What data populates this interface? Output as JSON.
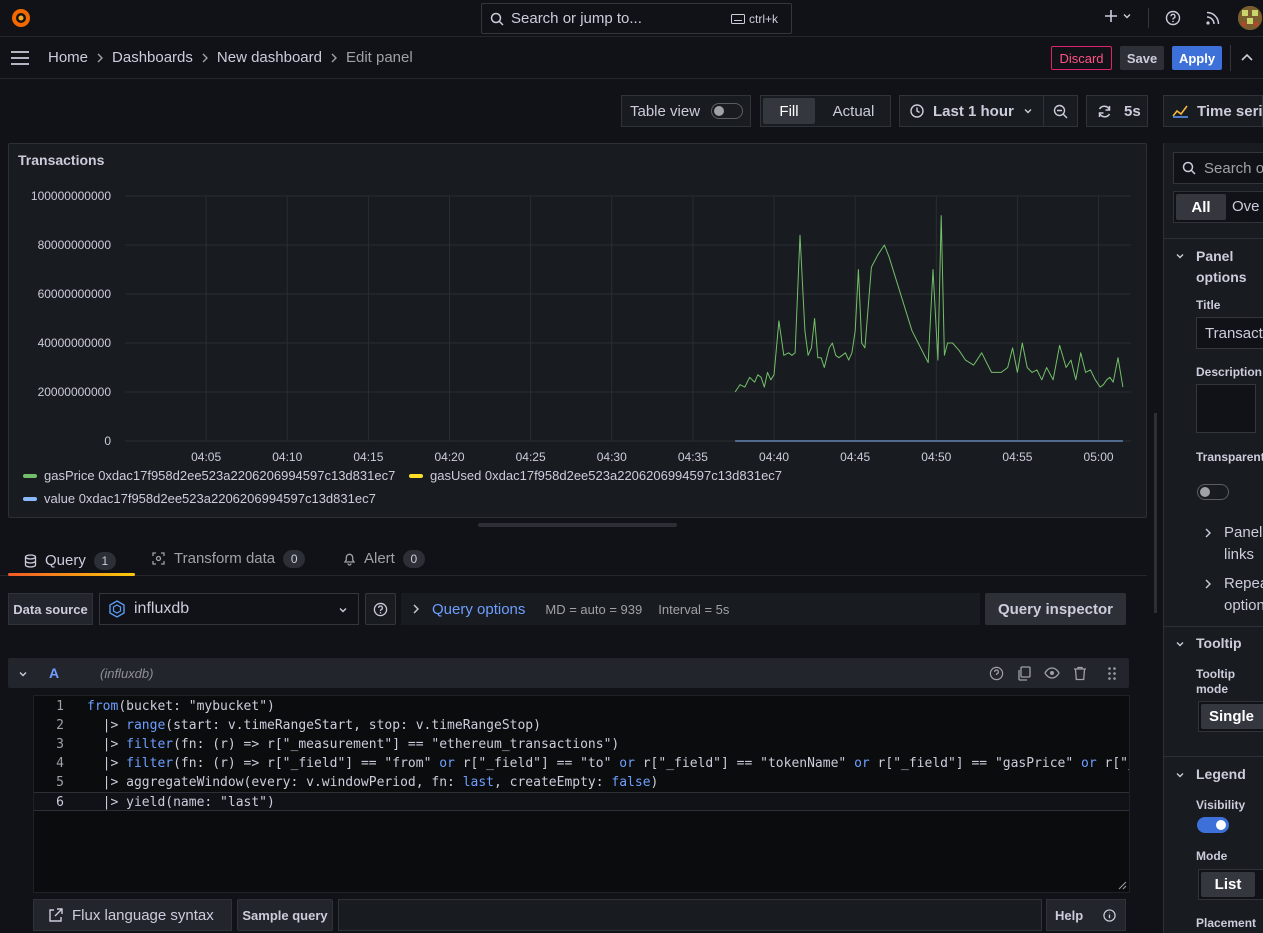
{
  "topbar": {
    "search_placeholder": "Search or jump to...",
    "search_shortcut": "ctrl+k"
  },
  "breadcrumb": {
    "items": [
      "Home",
      "Dashboards",
      "New dashboard",
      "Edit panel"
    ]
  },
  "actions": {
    "discard": "Discard",
    "save": "Save",
    "apply": "Apply"
  },
  "toolbar": {
    "table_view": "Table view",
    "fill": "Fill",
    "actual": "Actual",
    "time_range": "Last 1 hour",
    "refresh": "5s",
    "viz": "Time series"
  },
  "panel": {
    "title": "Transactions",
    "legend": [
      {
        "label": "gasPrice 0xdac17f958d2ee523a2206206994597c13d831ec7",
        "color": "#73bf69"
      },
      {
        "label": "gasUsed 0xdac17f958d2ee523a2206206994597c13d831ec7",
        "color": "#fade2a"
      },
      {
        "label": "value 0xdac17f958d2ee523a2206206994597c13d831ec7",
        "color": "#8ab8ff"
      }
    ]
  },
  "chart_data": {
    "type": "line",
    "y_ticks": [
      "100000000000",
      "80000000000",
      "60000000000",
      "40000000000",
      "20000000000",
      "0"
    ],
    "x_ticks": [
      "04:05",
      "04:10",
      "04:15",
      "04:20",
      "04:25",
      "04:30",
      "04:35",
      "04:40",
      "04:45",
      "04:50",
      "04:55",
      "05:00"
    ],
    "ylim": [
      0,
      100000000000
    ],
    "series": [
      {
        "name": "gasPrice 0xdac17f958d2ee523a2206206994597c13d831ec7",
        "color": "#73bf69",
        "x_minutes": [
          37.6,
          37.9,
          38.2,
          38.5,
          38.8,
          39.0,
          39.2,
          39.4,
          39.6,
          39.8,
          40.0,
          40.3,
          40.6,
          40.9,
          41.1,
          41.3,
          41.6,
          41.9,
          42.1,
          42.3,
          42.5,
          42.7,
          42.9,
          43.1,
          43.4,
          43.6,
          43.8,
          44.0,
          44.2,
          44.4,
          44.6,
          44.8,
          45.0,
          45.2,
          45.4,
          45.6,
          46.0,
          46.4,
          46.8,
          47.1,
          48.5,
          49.5,
          49.8,
          50.1,
          50.3,
          50.5,
          50.7,
          51.0,
          51.4,
          51.8,
          52.3,
          52.8,
          53.4,
          54.0,
          54.4,
          54.7,
          55.0,
          55.3,
          55.6,
          55.9,
          56.2,
          56.5,
          56.8,
          57.2,
          57.6,
          58.0,
          58.3,
          58.6,
          58.9,
          59.2,
          59.5,
          59.8,
          60.1,
          60.3,
          60.5,
          60.7,
          60.9,
          61.2,
          61.5
        ],
        "values": [
          20000000000,
          23000000000,
          22000000000,
          26000000000,
          24000000000,
          27000000000,
          26000000000,
          22000000000,
          28000000000,
          25000000000,
          27000000000,
          49000000000,
          35000000000,
          36000000000,
          35000000000,
          36000000000,
          84000000000,
          45000000000,
          35000000000,
          38000000000,
          50000000000,
          34000000000,
          34000000000,
          30000000000,
          38000000000,
          40000000000,
          35000000000,
          34000000000,
          35000000000,
          36000000000,
          33000000000,
          36000000000,
          45000000000,
          70000000000,
          40000000000,
          38000000000,
          71000000000,
          76000000000,
          80000000000,
          75000000000,
          45000000000,
          32000000000,
          70000000000,
          33000000000,
          92000000000,
          35000000000,
          40000000000,
          40000000000,
          37000000000,
          33000000000,
          31000000000,
          36000000000,
          28000000000,
          28000000000,
          30000000000,
          38000000000,
          28000000000,
          40000000000,
          30000000000,
          28000000000,
          29000000000,
          25000000000,
          30000000000,
          25000000000,
          39000000000,
          30000000000,
          33000000000,
          25000000000,
          36000000000,
          28000000000,
          29000000000,
          25000000000,
          22000000000,
          23000000000,
          25000000000,
          26000000000,
          24000000000,
          34000000000,
          22000000000
        ]
      },
      {
        "name": "value 0xdac17f958d2ee523a2206206994597c13d831ec7",
        "color": "#8ab8ff",
        "x_minutes": [
          37.6,
          61.5
        ],
        "values": [
          0,
          0
        ]
      }
    ]
  },
  "tabs": [
    {
      "label": "Query",
      "count": "1"
    },
    {
      "label": "Transform data",
      "count": "0"
    },
    {
      "label": "Alert",
      "count": "0"
    }
  ],
  "datasource": {
    "label": "Data source",
    "name": "influxdb",
    "query_options": "Query options",
    "md": "MD = auto = 939",
    "interval": "Interval = 5s",
    "inspector": "Query inspector"
  },
  "query": {
    "ref": "A",
    "source": "(influxdb)",
    "lines": [
      {
        "n": "1",
        "html": "<span class=\"kw\">from</span>(bucket: \"mybucket\")"
      },
      {
        "n": "2",
        "html": "  |&gt; <span class=\"kw\">range</span>(start: v.timeRangeStart, stop: v.timeRangeStop)"
      },
      {
        "n": "3",
        "html": "  |&gt; <span class=\"kw\">filter</span>(fn: (r) =&gt; r[\"_measurement\"] == \"ethereum_transactions\")"
      },
      {
        "n": "4",
        "html": "  |&gt; <span class=\"kw\">filter</span>(fn: (r) =&gt; r[\"_field\"] == \"from\" <span class=\"kw\">or</span> r[\"_field\"] == \"to\" <span class=\"kw\">or</span> r[\"_field\"] == \"tokenName\" <span class=\"kw\">or</span> r[\"_field\"] == \"gasPrice\" <span class=\"kw\">or</span> r[\"_fi"
      },
      {
        "n": "5",
        "html": "  |&gt; aggregateWindow(every: v.windowPeriod, fn: <span class=\"kw\">last</span>, createEmpty: <span class=\"kw\">false</span>)"
      },
      {
        "n": "6",
        "html": "  |&gt; yield(name: \"last\")"
      }
    ]
  },
  "footer": {
    "flux": "Flux language syntax",
    "sample": "Sample query",
    "help": "Help"
  },
  "sidebar": {
    "search_placeholder": "Search o",
    "tab_all": "All",
    "tab_overrides": "Ove",
    "panel_options": "Panel options",
    "title_label": "Title",
    "title_value": "Transactions",
    "description_label": "Description",
    "transparent_label": "Transparent background",
    "panel_links": "Panel links",
    "repeat_options": "Repeat options",
    "tooltip": "Tooltip",
    "tooltip_mode_label": "Tooltip mode",
    "tooltip_mode_value": "Single",
    "legend": "Legend",
    "visibility_label": "Visibility",
    "mode_label": "Mode",
    "mode_value": "List",
    "placement_label": "Placement"
  }
}
